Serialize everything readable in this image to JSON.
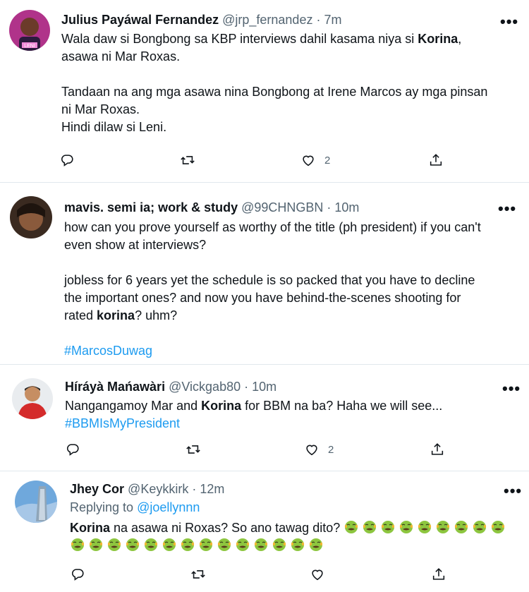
{
  "tweets": [
    {
      "name": "Julius Payáwal Fernandez",
      "handle": "@jrp_fernandez",
      "time": "7m",
      "more": "•••",
      "lines": [
        {
          "parts": [
            "Wala daw si Bongbong sa KBP interviews dahil kasama niya si ",
            "Korina",
            ","
          ]
        },
        {
          "text": "asawa ni Mar Roxas."
        },
        {
          "text": "Tandaan na ang mga asawa nina Bongbong at Irene Marcos ay mga pinsan"
        },
        {
          "text": "ni Mar Roxas."
        },
        {
          "text": "Hindi dilaw si Leni."
        }
      ],
      "avatar_badge": "LENI",
      "likes": "2"
    },
    {
      "name": "mavis. semi ia; work & study",
      "handle": "@99CHNGBN",
      "time": "10m",
      "more": "•••",
      "lines": [
        {
          "text": "how can you prove yourself as worthy of the title (ph president) if you can't"
        },
        {
          "text": "even show at interviews?"
        },
        {
          "text": "jobless for 6 years yet the schedule is so packed that you have to decline"
        },
        {
          "text": "the important ones? and now you have behind-the-scenes shooting for"
        },
        {
          "parts": [
            "rated ",
            "korina",
            "? uhm?"
          ]
        },
        {
          "hashtag": "#MarcosDuwag"
        }
      ]
    },
    {
      "name": "Híráyà Mańawàri",
      "handle": "@Vickgab80",
      "time": "10m",
      "more": "•••",
      "lines": [
        {
          "parts": [
            "Nangangamoy Mar and ",
            "Korina",
            " for BBM na ba? Haha we will see..."
          ]
        },
        {
          "hashtag": "#BBMIsMyPresident"
        }
      ],
      "likes": "2"
    },
    {
      "name": "Jhey Cor",
      "handle": "@Keykkirk",
      "time": "12m",
      "more": "•••",
      "replying_prefix": "Replying to ",
      "replying_to": "@joellynnn",
      "lines": [
        {
          "parts": [
            "Korina",
            " na asawa ni Roxas? So ano tawag dito? "
          ]
        }
      ],
      "emoji_name": "nauseated-face-emoji",
      "emoji_row1_count": 9,
      "emoji_row2_count": 14
    }
  ],
  "separator": " · ",
  "colors": {
    "accent": "#1d9bf0",
    "muted": "#536471",
    "text": "#0f1419",
    "divider": "#e1e8ed"
  },
  "icons": [
    "reply-icon",
    "retweet-icon",
    "like-icon",
    "share-icon",
    "more-icon"
  ]
}
